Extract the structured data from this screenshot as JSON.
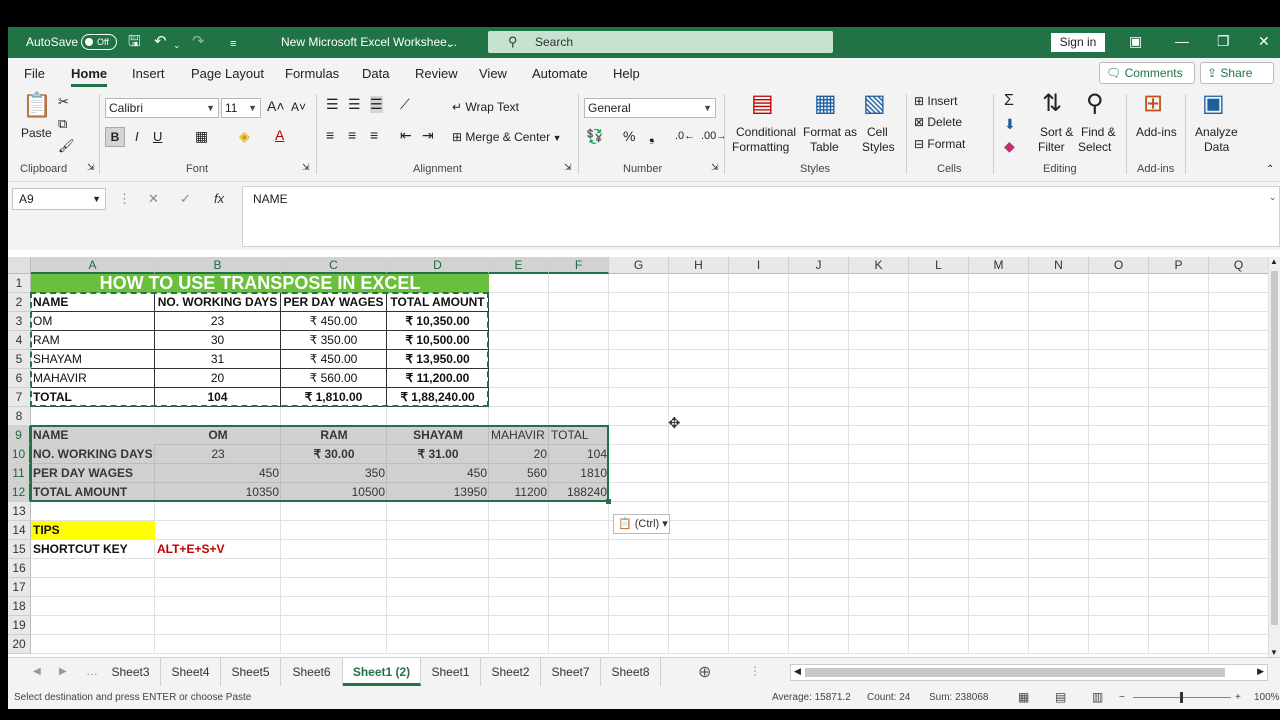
{
  "titlebar": {
    "autosave_label": "AutoSave",
    "autosave_state": "Off",
    "doc_title": "New Microsoft Excel Workshee...",
    "search_placeholder": "Search",
    "signin_label": "Sign in",
    "accent": "#217346"
  },
  "menu": {
    "tabs": [
      "File",
      "Home",
      "Insert",
      "Page Layout",
      "Formulas",
      "Data",
      "Review",
      "View",
      "Automate",
      "Help"
    ],
    "active": "Home",
    "comments_label": "Comments",
    "share_label": "Share"
  },
  "ribbon": {
    "clipboard": {
      "paste": "Paste",
      "label": "Clipboard"
    },
    "font": {
      "name": "Calibri",
      "size": "11",
      "label": "Font"
    },
    "alignment": {
      "wrap": "Wrap Text",
      "merge": "Merge & Center",
      "label": "Alignment"
    },
    "number": {
      "format": "General",
      "label": "Number"
    },
    "styles": {
      "conditional_1": "Conditional",
      "conditional_2": "Formatting",
      "format_table_1": "Format as",
      "format_table_2": "Table",
      "cell_styles_1": "Cell",
      "cell_styles_2": "Styles",
      "label": "Styles"
    },
    "cells": {
      "insert": "Insert",
      "delete": "Delete",
      "format": "Format",
      "label": "Cells"
    },
    "editing": {
      "sort_1": "Sort &",
      "sort_2": "Filter",
      "find_1": "Find &",
      "find_2": "Select",
      "label": "Editing"
    },
    "addins": {
      "btn": "Add-ins",
      "label": "Add-ins"
    },
    "analyze": {
      "line1": "Analyze",
      "line2": "Data"
    }
  },
  "formula_bar": {
    "name_box": "A9",
    "formula": "NAME"
  },
  "grid": {
    "columns": [
      "A",
      "B",
      "C",
      "D",
      "E",
      "F",
      "G",
      "H",
      "I",
      "J",
      "K",
      "L",
      "M",
      "N",
      "O",
      "P",
      "Q"
    ],
    "rows": [
      "1",
      "2",
      "3",
      "4",
      "5",
      "6",
      "7",
      "8",
      "9",
      "10",
      "11",
      "12",
      "13",
      "14",
      "15",
      "16",
      "17",
      "18",
      "19",
      "20"
    ],
    "title": "HOW TO USE TRANSPOSE IN EXCEL",
    "title_color": "#6abf3c",
    "table1": {
      "headers": [
        "NAME",
        "NO. WORKING DAYS",
        "PER DAY WAGES",
        "TOTAL AMOUNT"
      ],
      "rows": [
        [
          "OM",
          "23",
          "₹ 450.00",
          "₹ 10,350.00"
        ],
        [
          "RAM",
          "30",
          "₹ 350.00",
          "₹ 10,500.00"
        ],
        [
          "SHAYAM",
          "31",
          "₹ 450.00",
          "₹ 13,950.00"
        ],
        [
          "MAHAVIR",
          "20",
          "₹ 560.00",
          "₹ 11,200.00"
        ],
        [
          "TOTAL",
          "104",
          "₹ 1,810.00",
          "₹ 1,88,240.00"
        ]
      ]
    },
    "table2": {
      "rows": [
        [
          "NAME",
          "OM",
          "RAM",
          "SHAYAM",
          "MAHAVIR",
          "TOTAL"
        ],
        [
          "NO. WORKING DAYS",
          "23",
          "₹ 30.00",
          "₹ 31.00",
          "20",
          "104"
        ],
        [
          "PER DAY WAGES",
          "450",
          "350",
          "450",
          "560",
          "1810"
        ],
        [
          "TOTAL AMOUNT",
          "10350",
          "10500",
          "13950",
          "11200",
          "188240"
        ]
      ]
    },
    "tips_label": "TIPS",
    "tips_color": "#ffff00",
    "shortcut_label": "SHORTCUT KEY",
    "shortcut_value": "ALT+E+S+V",
    "shortcut_color": "#c00000",
    "paste_options": "(Ctrl)"
  },
  "sheets": {
    "tabs": [
      "Sheet3",
      "Sheet4",
      "Sheet5",
      "Sheet6",
      "Sheet1 (2)",
      "Sheet1",
      "Sheet2",
      "Sheet7",
      "Sheet8"
    ],
    "active": "Sheet1 (2)"
  },
  "status": {
    "message": "Select destination and press ENTER or choose Paste",
    "average": "Average: 15871.2",
    "count": "Count: 24",
    "sum": "Sum: 238068",
    "zoom": "100%"
  }
}
